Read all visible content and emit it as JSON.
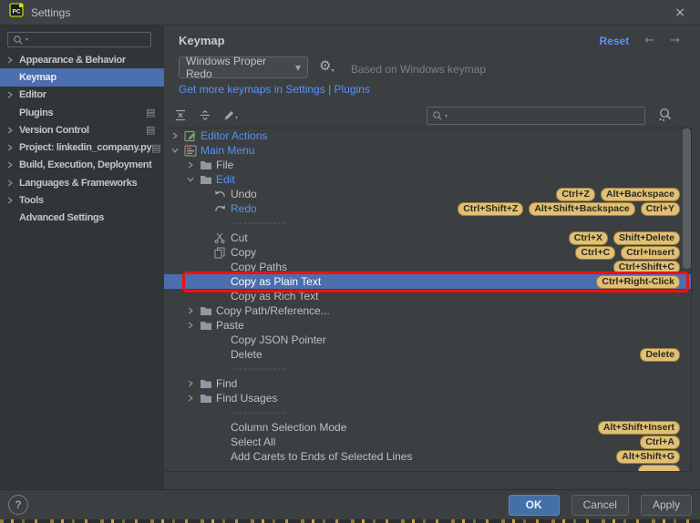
{
  "window": {
    "title": "Settings",
    "app_icon": "pycharm-logo",
    "close_icon": "close-icon"
  },
  "sidebar": {
    "search_placeholder": "",
    "items": [
      {
        "label": "Appearance & Behavior",
        "expandable": true
      },
      {
        "label": "Keymap",
        "selected": true
      },
      {
        "label": "Editor",
        "expandable": true
      },
      {
        "label": "Plugins",
        "badge": true
      },
      {
        "label": "Version Control",
        "expandable": true,
        "badge": true
      },
      {
        "label": "Project: linkedin_company.py",
        "expandable": true,
        "badge": true
      },
      {
        "label": "Build, Execution, Deployment",
        "expandable": true
      },
      {
        "label": "Languages & Frameworks",
        "expandable": true
      },
      {
        "label": "Tools",
        "expandable": true
      },
      {
        "label": "Advanced Settings"
      }
    ]
  },
  "keymap": {
    "title": "Keymap",
    "reset_label": "Reset",
    "scheme_value": "Windows Proper Redo",
    "based_on": "Based on Windows keymap",
    "more_link": "Get more keymaps in Settings | Plugins",
    "search_placeholder": ""
  },
  "tree": {
    "separator_text": "-------------",
    "rows": [
      {
        "depth": 0,
        "state": "collapsed",
        "icon": "editor-actions-icon",
        "label": "Editor Actions",
        "modified": true
      },
      {
        "depth": 0,
        "state": "expanded",
        "icon": "main-menu-icon",
        "label": "Main Menu",
        "modified": true
      },
      {
        "depth": 1,
        "state": "collapsed",
        "icon": "folder-icon",
        "label": "File"
      },
      {
        "depth": 1,
        "state": "expanded",
        "icon": "folder-icon",
        "label": "Edit",
        "modified": true
      },
      {
        "depth": 2,
        "icon": "undo-icon",
        "label": "Undo",
        "shortcuts": [
          "Ctrl+Z",
          "Alt+Backspace"
        ]
      },
      {
        "depth": 2,
        "icon": "redo-icon",
        "label": "Redo",
        "modified": true,
        "shortcuts": [
          "Ctrl+Shift+Z",
          "Alt+Shift+Backspace",
          "Ctrl+Y"
        ]
      },
      {
        "depth": 2,
        "separator": true
      },
      {
        "depth": 2,
        "icon": "cut-icon",
        "label": "Cut",
        "shortcuts": [
          "Ctrl+X",
          "Shift+Delete"
        ]
      },
      {
        "depth": 2,
        "icon": "copy-icon",
        "label": "Copy",
        "shortcuts": [
          "Ctrl+C",
          "Ctrl+Insert"
        ]
      },
      {
        "depth": 2,
        "label": "Copy Paths",
        "shortcuts": [
          "Ctrl+Shift+C"
        ]
      },
      {
        "depth": 2,
        "label": "Copy as Plain Text",
        "selected": true,
        "shortcuts": [
          "Ctrl+Right-Click"
        ]
      },
      {
        "depth": 2,
        "label": "Copy as Rich Text"
      },
      {
        "depth": 1,
        "state": "collapsed",
        "icon": "folder-icon",
        "label": "Copy Path/Reference..."
      },
      {
        "depth": 1,
        "state": "collapsed",
        "icon": "folder-icon",
        "label": "Paste"
      },
      {
        "depth": 2,
        "label": "Copy JSON Pointer"
      },
      {
        "depth": 2,
        "label": "Delete",
        "shortcuts": [
          "Delete"
        ]
      },
      {
        "depth": 2,
        "separator": true
      },
      {
        "depth": 1,
        "state": "collapsed",
        "icon": "folder-icon",
        "label": "Find"
      },
      {
        "depth": 1,
        "state": "collapsed",
        "icon": "folder-icon",
        "label": "Find Usages"
      },
      {
        "depth": 2,
        "separator": true
      },
      {
        "depth": 2,
        "label": "Column Selection Mode",
        "shortcuts": [
          "Alt+Shift+Insert"
        ]
      },
      {
        "depth": 2,
        "label": "Select All",
        "shortcuts": [
          "Ctrl+A"
        ]
      },
      {
        "depth": 2,
        "label": "Add Carets to Ends of Selected Lines",
        "shortcuts": [
          "Alt+Shift+G"
        ]
      },
      {
        "depth": 2,
        "label": "",
        "partial_badge": true
      }
    ]
  },
  "footer": {
    "help": "?",
    "ok": "OK",
    "cancel": "Cancel",
    "apply": "Apply"
  },
  "icons": [
    "pycharm-logo",
    "close-icon",
    "search-icon",
    "search-caret-icon",
    "chevron-right-icon",
    "chevron-down-icon",
    "settings-badge-icon",
    "back-arrow-icon",
    "forward-arrow-icon",
    "combo-arrow-icon",
    "gear-icon",
    "expand-all-icon",
    "collapse-all-icon",
    "edit-pencil-icon",
    "find-by-shortcut-icon",
    "editor-actions-icon",
    "main-menu-icon",
    "folder-icon",
    "undo-icon",
    "redo-icon",
    "cut-icon",
    "copy-icon",
    "help-icon"
  ],
  "colors": {
    "selection_blue": "#4b6eaf",
    "link_blue": "#5a92f5",
    "shortcut_badge_bg": "#e2bf74",
    "annotation_red": "#ee1111",
    "panel_bg": "#3c3f41",
    "sidebar_bg": "#313538"
  }
}
